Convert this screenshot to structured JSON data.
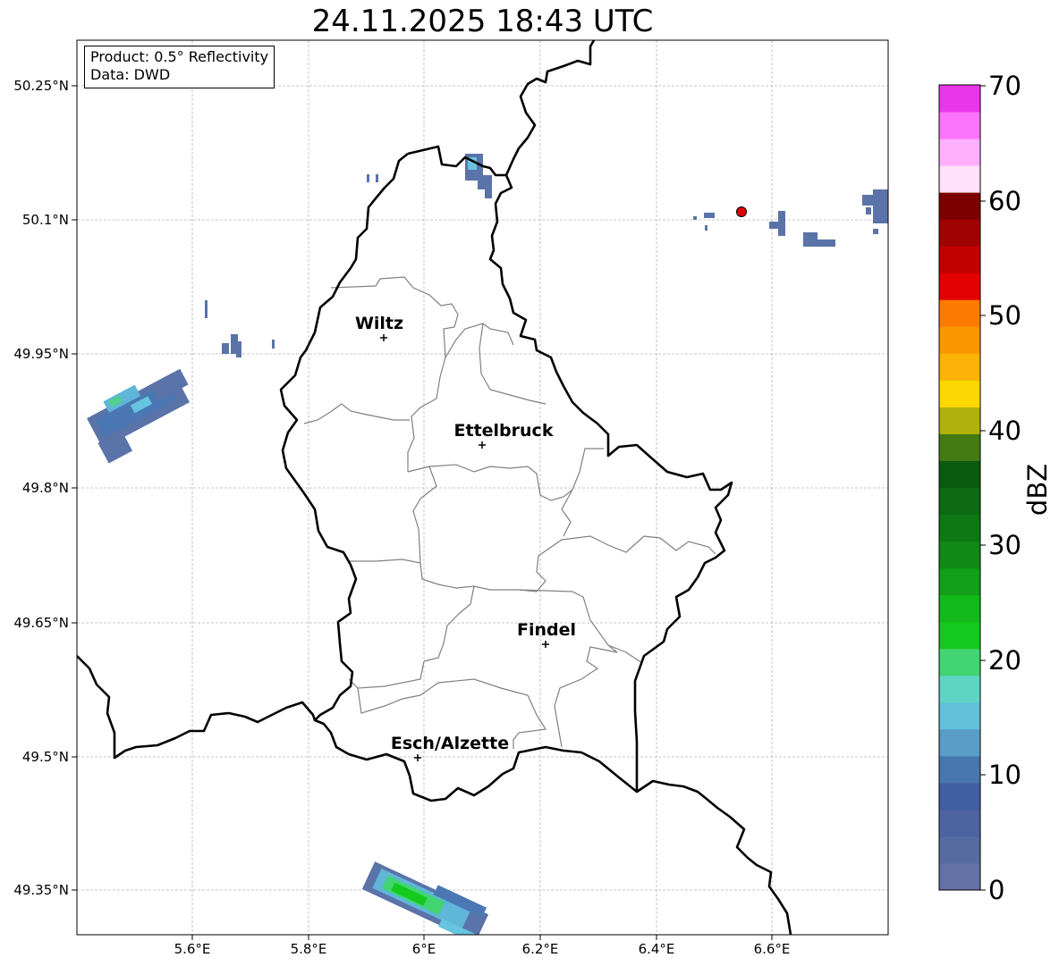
{
  "title": "24.11.2025 18:43 UTC",
  "info": {
    "product": "Product: 0.5° Reflectivity",
    "data": "Data: DWD"
  },
  "lat_ticks": [
    "50.25°N",
    "50.1°N",
    "49.95°N",
    "49.8°N",
    "49.65°N",
    "49.5°N",
    "49.35°N"
  ],
  "lon_ticks": [
    "5.6°E",
    "5.8°E",
    "6°E",
    "6.2°E",
    "6.4°E",
    "6.6°E"
  ],
  "cities": [
    {
      "name": "Wiltz"
    },
    {
      "name": "Ettelbruck"
    },
    {
      "name": "Findel"
    },
    {
      "name": "Esch/Alzette"
    }
  ],
  "colorbar": {
    "label": "dBZ",
    "ticks": [
      "0",
      "10",
      "20",
      "30",
      "40",
      "50",
      "60",
      "70"
    ],
    "colors": [
      "#6372a6",
      "#566ba0",
      "#4d64a0",
      "#425ea3",
      "#4877af",
      "#5a9ec7",
      "#64c1dc",
      "#5ed5c4",
      "#42d471",
      "#15c91f",
      "#12b91a",
      "#119e18",
      "#108a15",
      "#0e7914",
      "#0c6a12",
      "#0a5a0f",
      "#437a12",
      "#b0b20b",
      "#fbd802",
      "#fbb307",
      "#f99701",
      "#fe7b01",
      "#e30100",
      "#c10100",
      "#a00101",
      "#7b0101",
      "#ffe1f9",
      "#feb0fd",
      "#fd74fc",
      "#ea36ea"
    ]
  },
  "marker_color": "#e00000"
}
